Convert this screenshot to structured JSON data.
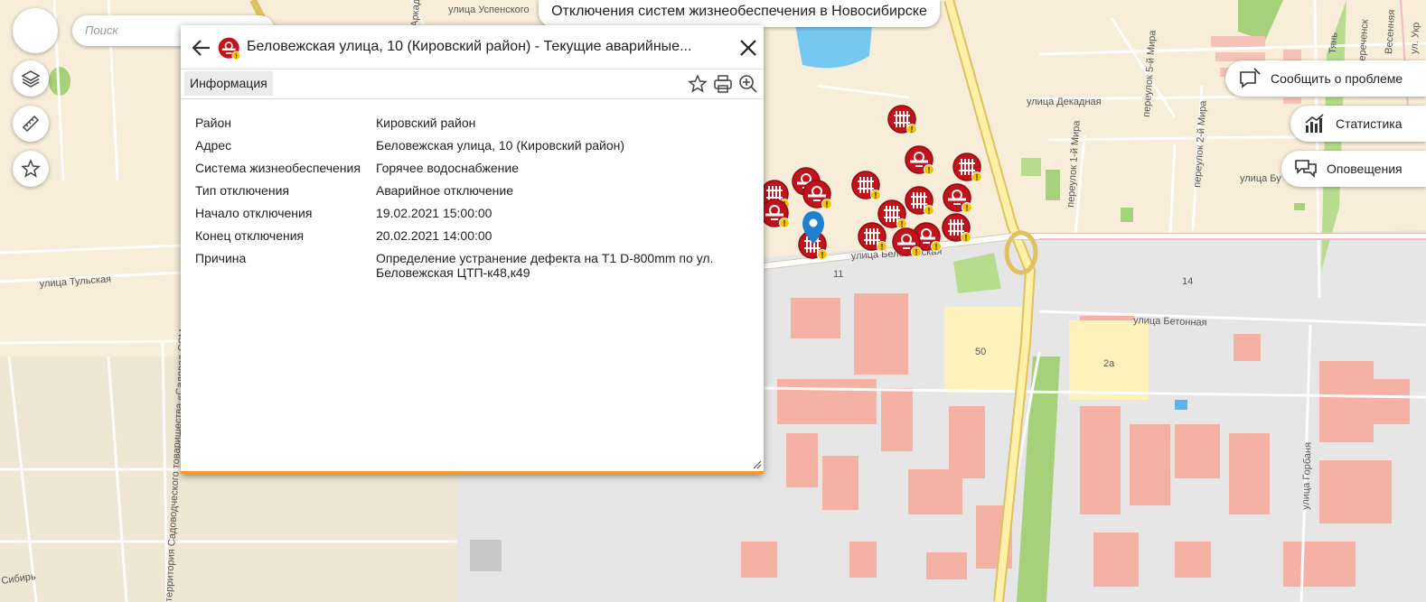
{
  "app": {
    "title": "Отключения систем жизнеобеспечения в Новосибирске"
  },
  "search": {
    "placeholder": "Поиск"
  },
  "left_controls": [
    {
      "icon": "home-icon"
    },
    {
      "icon": "layers-icon"
    },
    {
      "icon": "ruler-icon"
    },
    {
      "icon": "star-icon"
    }
  ],
  "right_buttons": {
    "report": "Сообщить о проблеме",
    "stats": "Статистика",
    "alerts": "Оповещения"
  },
  "popup": {
    "title": "Беловежская улица, 10 (Кировский район) - Текущие аварийные...",
    "tab": "Информация",
    "rows": [
      {
        "label": "Район",
        "value": "Кировский район"
      },
      {
        "label": "Адрес",
        "value": "Беловежская улица, 10 (Кировский район)"
      },
      {
        "label": "Система жизнеобеспечения",
        "value": "Горячее водоснабжение"
      },
      {
        "label": "Тип отключения",
        "value": "Аварийное отключение"
      },
      {
        "label": "Начало отключения",
        "value": "19.02.2021 15:00:00"
      },
      {
        "label": "Конец отключения",
        "value": "20.02.2021 14:00:00"
      },
      {
        "label": "Причина",
        "value": "Определение устранение дефекта на Т1 D-800mm по ул. Беловежская ЦТП-к48,к49"
      }
    ],
    "accent_color": "#f39a2b"
  },
  "map": {
    "street_labels": {
      "uspenskogo": "улица Успенского",
      "tulskaya": "улица Тульская",
      "belovezhskaya": "улица Беловежская",
      "dekadnaya": "улица Декадная",
      "betonnaya": "улица Бетонная",
      "gorbanya": "улица Горбаня",
      "mira1": "переулок 1-й Мира",
      "mira2": "переулок 2-й Мира",
      "mira5": "переулок 5-й Мира",
      "bur": "улица Бу",
      "sadovod": "территория Садоводческого товарищества «Садовод-ССМ»",
      "sibir": "Сибирь",
      "arkad": "Аркады",
      "tyan": "Тянь",
      "bereche": "Береченск",
      "vesenn": "Весенняя",
      "ykr": "ул. Укр"
    },
    "building_labels": {
      "b11": "11",
      "b14": "14",
      "b50": "50",
      "b2a": "2а"
    },
    "markers": {
      "outage_color": "#c2121b",
      "warning_color": "#f5c400",
      "pin_color": "#1f7fd0"
    }
  }
}
